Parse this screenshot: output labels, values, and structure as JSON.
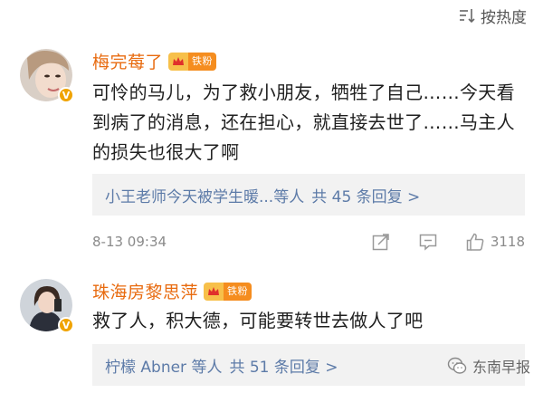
{
  "sort": {
    "label": "按热度"
  },
  "comments": [
    {
      "username": "梅完莓了",
      "fan_badge": "铁粉",
      "text": "可怜的马儿，为了救小朋友，牺牲了自己……今天看到病了的消息，还在担心，就直接去世了……马主人的损失也很大了啊",
      "reply_from": "小王老师今天被学生暖...等人",
      "reply_count": "共 45 条回复 >",
      "time": "8-13 09:34",
      "likes": "3118"
    },
    {
      "username": "珠海房黎思萍",
      "fan_badge": "铁粉",
      "text": "救了人，积大德，可能要转世去做人了吧",
      "reply_from": "柠檬 Abner 等人",
      "reply_count": "共 51 条回复 >"
    }
  ],
  "watermark": {
    "label": "东南早报"
  },
  "colors": {
    "username": "#e86b10",
    "reply_link": "#5d7ba8",
    "badge": "#f58d1f"
  }
}
